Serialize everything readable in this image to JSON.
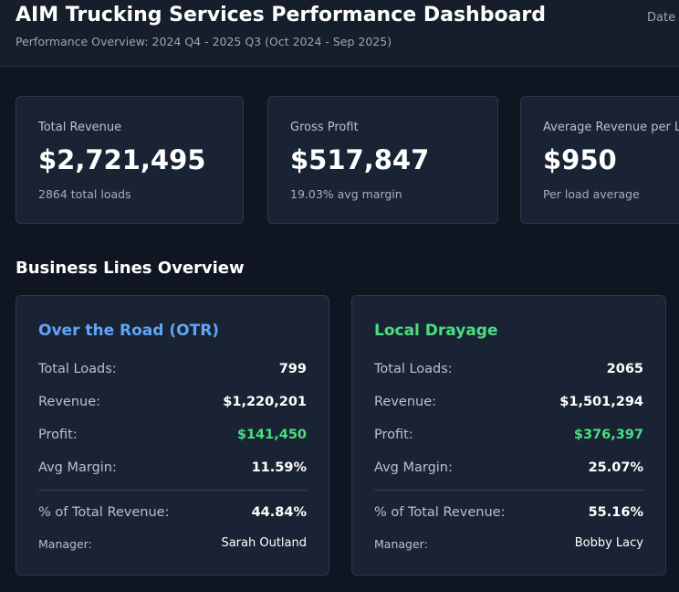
{
  "header": {
    "title": "AIM Trucking Services Performance Dashboard",
    "subtitle": "Performance Overview: 2024 Q4 - 2025 Q3 (Oct 2024 - Sep 2025)",
    "date_label": "Date I"
  },
  "kpis": [
    {
      "label": "Total Revenue",
      "value": "$2,721,495",
      "sub": "2864 total loads"
    },
    {
      "label": "Gross Profit",
      "value": "$517,847",
      "sub": "19.03% avg margin"
    },
    {
      "label": "Average Revenue per Lo",
      "value": "$950",
      "sub": "Per load average"
    }
  ],
  "business_lines": {
    "section_title": "Business Lines Overview",
    "lines": [
      {
        "title": "Over the Road (OTR)",
        "color": "#60a5fa",
        "total_loads_label": "Total Loads:",
        "total_loads": "799",
        "revenue_label": "Revenue:",
        "revenue": "$1,220,201",
        "profit_label": "Profit:",
        "profit": "$141,450",
        "avg_margin_label": "Avg Margin:",
        "avg_margin": "11.59%",
        "pct_label": "% of Total Revenue:",
        "pct": "44.84%",
        "manager_label": "Manager:",
        "manager": "Sarah Outland"
      },
      {
        "title": "Local Drayage",
        "color": "#4ade80",
        "total_loads_label": "Total Loads:",
        "total_loads": "2065",
        "revenue_label": "Revenue:",
        "revenue": "$1,501,294",
        "profit_label": "Profit:",
        "profit": "$376,397",
        "avg_margin_label": "Avg Margin:",
        "avg_margin": "25.07%",
        "pct_label": "% of Total Revenue:",
        "pct": "55.16%",
        "manager_label": "Manager:",
        "manager": "Bobby Lacy"
      }
    ]
  },
  "colors": {
    "background": "#0f1521",
    "card": "#1a2333",
    "profit_green": "#4ade80",
    "otr_blue": "#60a5fa"
  }
}
